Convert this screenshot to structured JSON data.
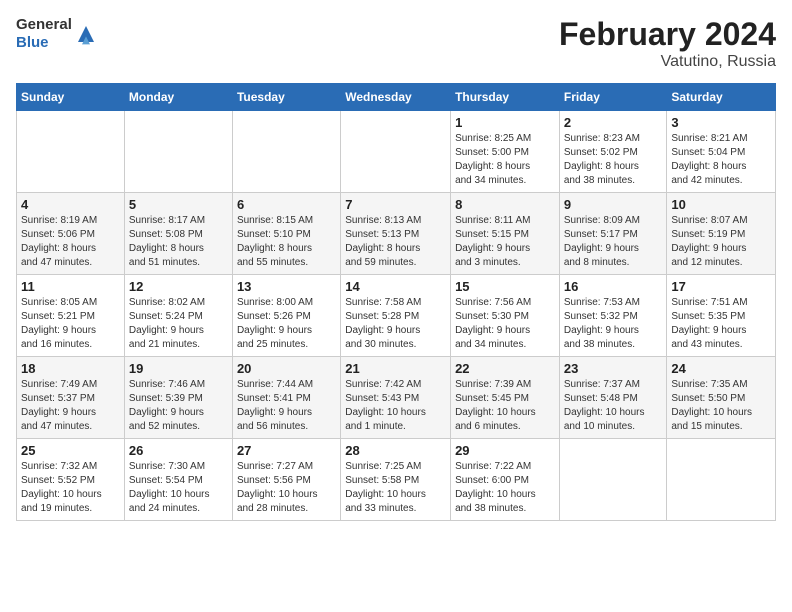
{
  "header": {
    "logo_general": "General",
    "logo_blue": "Blue",
    "title": "February 2024",
    "subtitle": "Vatutino, Russia"
  },
  "weekdays": [
    "Sunday",
    "Monday",
    "Tuesday",
    "Wednesday",
    "Thursday",
    "Friday",
    "Saturday"
  ],
  "weeks": [
    [
      {
        "day": "",
        "info": ""
      },
      {
        "day": "",
        "info": ""
      },
      {
        "day": "",
        "info": ""
      },
      {
        "day": "",
        "info": ""
      },
      {
        "day": "1",
        "info": "Sunrise: 8:25 AM\nSunset: 5:00 PM\nDaylight: 8 hours\nand 34 minutes."
      },
      {
        "day": "2",
        "info": "Sunrise: 8:23 AM\nSunset: 5:02 PM\nDaylight: 8 hours\nand 38 minutes."
      },
      {
        "day": "3",
        "info": "Sunrise: 8:21 AM\nSunset: 5:04 PM\nDaylight: 8 hours\nand 42 minutes."
      }
    ],
    [
      {
        "day": "4",
        "info": "Sunrise: 8:19 AM\nSunset: 5:06 PM\nDaylight: 8 hours\nand 47 minutes."
      },
      {
        "day": "5",
        "info": "Sunrise: 8:17 AM\nSunset: 5:08 PM\nDaylight: 8 hours\nand 51 minutes."
      },
      {
        "day": "6",
        "info": "Sunrise: 8:15 AM\nSunset: 5:10 PM\nDaylight: 8 hours\nand 55 minutes."
      },
      {
        "day": "7",
        "info": "Sunrise: 8:13 AM\nSunset: 5:13 PM\nDaylight: 8 hours\nand 59 minutes."
      },
      {
        "day": "8",
        "info": "Sunrise: 8:11 AM\nSunset: 5:15 PM\nDaylight: 9 hours\nand 3 minutes."
      },
      {
        "day": "9",
        "info": "Sunrise: 8:09 AM\nSunset: 5:17 PM\nDaylight: 9 hours\nand 8 minutes."
      },
      {
        "day": "10",
        "info": "Sunrise: 8:07 AM\nSunset: 5:19 PM\nDaylight: 9 hours\nand 12 minutes."
      }
    ],
    [
      {
        "day": "11",
        "info": "Sunrise: 8:05 AM\nSunset: 5:21 PM\nDaylight: 9 hours\nand 16 minutes."
      },
      {
        "day": "12",
        "info": "Sunrise: 8:02 AM\nSunset: 5:24 PM\nDaylight: 9 hours\nand 21 minutes."
      },
      {
        "day": "13",
        "info": "Sunrise: 8:00 AM\nSunset: 5:26 PM\nDaylight: 9 hours\nand 25 minutes."
      },
      {
        "day": "14",
        "info": "Sunrise: 7:58 AM\nSunset: 5:28 PM\nDaylight: 9 hours\nand 30 minutes."
      },
      {
        "day": "15",
        "info": "Sunrise: 7:56 AM\nSunset: 5:30 PM\nDaylight: 9 hours\nand 34 minutes."
      },
      {
        "day": "16",
        "info": "Sunrise: 7:53 AM\nSunset: 5:32 PM\nDaylight: 9 hours\nand 38 minutes."
      },
      {
        "day": "17",
        "info": "Sunrise: 7:51 AM\nSunset: 5:35 PM\nDaylight: 9 hours\nand 43 minutes."
      }
    ],
    [
      {
        "day": "18",
        "info": "Sunrise: 7:49 AM\nSunset: 5:37 PM\nDaylight: 9 hours\nand 47 minutes."
      },
      {
        "day": "19",
        "info": "Sunrise: 7:46 AM\nSunset: 5:39 PM\nDaylight: 9 hours\nand 52 minutes."
      },
      {
        "day": "20",
        "info": "Sunrise: 7:44 AM\nSunset: 5:41 PM\nDaylight: 9 hours\nand 56 minutes."
      },
      {
        "day": "21",
        "info": "Sunrise: 7:42 AM\nSunset: 5:43 PM\nDaylight: 10 hours\nand 1 minute."
      },
      {
        "day": "22",
        "info": "Sunrise: 7:39 AM\nSunset: 5:45 PM\nDaylight: 10 hours\nand 6 minutes."
      },
      {
        "day": "23",
        "info": "Sunrise: 7:37 AM\nSunset: 5:48 PM\nDaylight: 10 hours\nand 10 minutes."
      },
      {
        "day": "24",
        "info": "Sunrise: 7:35 AM\nSunset: 5:50 PM\nDaylight: 10 hours\nand 15 minutes."
      }
    ],
    [
      {
        "day": "25",
        "info": "Sunrise: 7:32 AM\nSunset: 5:52 PM\nDaylight: 10 hours\nand 19 minutes."
      },
      {
        "day": "26",
        "info": "Sunrise: 7:30 AM\nSunset: 5:54 PM\nDaylight: 10 hours\nand 24 minutes."
      },
      {
        "day": "27",
        "info": "Sunrise: 7:27 AM\nSunset: 5:56 PM\nDaylight: 10 hours\nand 28 minutes."
      },
      {
        "day": "28",
        "info": "Sunrise: 7:25 AM\nSunset: 5:58 PM\nDaylight: 10 hours\nand 33 minutes."
      },
      {
        "day": "29",
        "info": "Sunrise: 7:22 AM\nSunset: 6:00 PM\nDaylight: 10 hours\nand 38 minutes."
      },
      {
        "day": "",
        "info": ""
      },
      {
        "day": "",
        "info": ""
      }
    ]
  ]
}
